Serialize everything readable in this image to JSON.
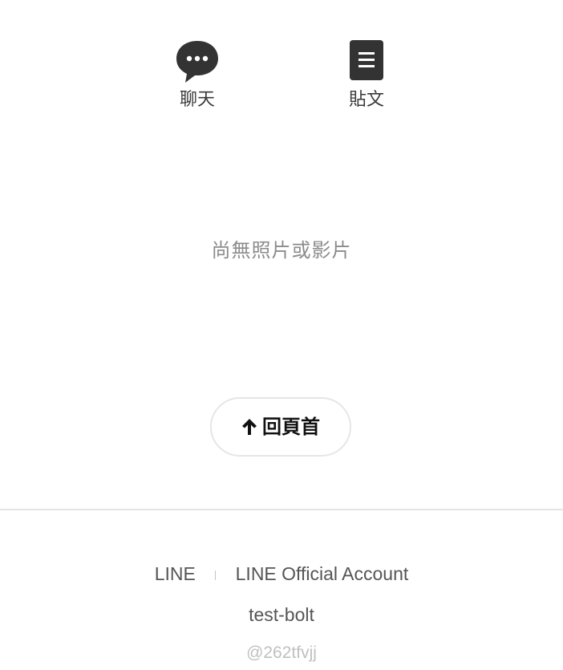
{
  "actions": {
    "chat": {
      "label": "聊天",
      "icon": "chat-bubble-icon"
    },
    "post": {
      "label": "貼文",
      "icon": "document-icon"
    }
  },
  "gallery": {
    "empty_message": "尚無照片或影片"
  },
  "back_to_top": {
    "label": "回頁首",
    "icon": "arrow-up-icon"
  },
  "footer": {
    "link_line": "LINE",
    "link_official": "LINE Official Account",
    "account_name": "test-bolt",
    "account_id": "@262tfvjj"
  },
  "colors": {
    "icon": "#333333",
    "empty_text": "#8c8c8c",
    "divider": "#e4e4e4",
    "footer_text": "#555555",
    "account_id": "#c0c0c0"
  }
}
